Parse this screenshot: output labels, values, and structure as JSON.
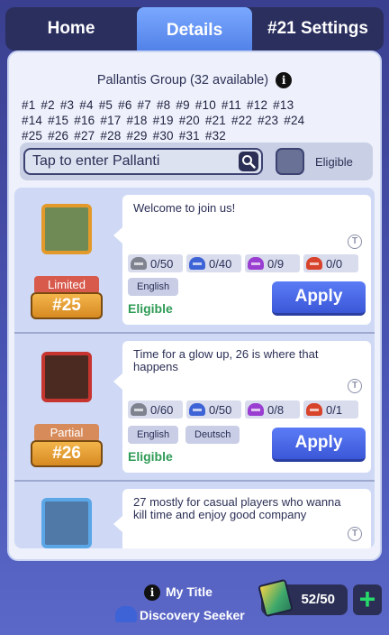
{
  "tabs": {
    "home": "Home",
    "details": "Details",
    "settings": "#21 Settings"
  },
  "group": {
    "title": "Pallantis Group (32 available)",
    "info_icon": "info-icon",
    "numbers": [
      "#1",
      "#2",
      "#3",
      "#4",
      "#5",
      "#6",
      "#7",
      "#8",
      "#9",
      "#10",
      "#11",
      "#12",
      "#13",
      "#14",
      "#15",
      "#16",
      "#17",
      "#18",
      "#19",
      "#20",
      "#21",
      "#22",
      "#23",
      "#24",
      "#25",
      "#26",
      "#27",
      "#28",
      "#29",
      "#30",
      "#31",
      "#32"
    ]
  },
  "search": {
    "placeholder": "Tap to enter Pallanti",
    "icon": "search-icon",
    "eligible_label": "Eligible"
  },
  "cards": [
    {
      "status": "Limited",
      "number": "#25",
      "description": "Welcome to join us!",
      "stats": [
        {
          "icon": "gray-helmet-icon",
          "value": "0/50"
        },
        {
          "icon": "blue-helmet-icon",
          "value": "0/40"
        },
        {
          "icon": "purple-helmet-icon",
          "value": "0/9"
        },
        {
          "icon": "red-helmet-icon",
          "value": "0/0"
        }
      ],
      "languages": [
        "English"
      ],
      "eligibility": "Eligible",
      "apply_label": "Apply"
    },
    {
      "status": "Partial",
      "number": "#26",
      "description": "Time for a glow up, 26 is where that happens",
      "stats": [
        {
          "icon": "gray-helmet-icon",
          "value": "0/60"
        },
        {
          "icon": "blue-helmet-icon",
          "value": "0/50"
        },
        {
          "icon": "purple-helmet-icon",
          "value": "0/8"
        },
        {
          "icon": "red-helmet-icon",
          "value": "0/1"
        }
      ],
      "languages": [
        "English",
        "Deutsch"
      ],
      "eligibility": "Eligible",
      "apply_label": "Apply"
    },
    {
      "description": "27 mostly for casual players who wanna kill time and enjoy good company"
    }
  ],
  "footer": {
    "my_title_label": "My Title",
    "title_value": "Discovery Seeker",
    "counter": "52/50",
    "plus": "+"
  },
  "colors": {
    "accent": "#4f7fe6",
    "eligible": "#2e9b55",
    "apply": "#3b57d8",
    "badge": "#d78a22"
  }
}
